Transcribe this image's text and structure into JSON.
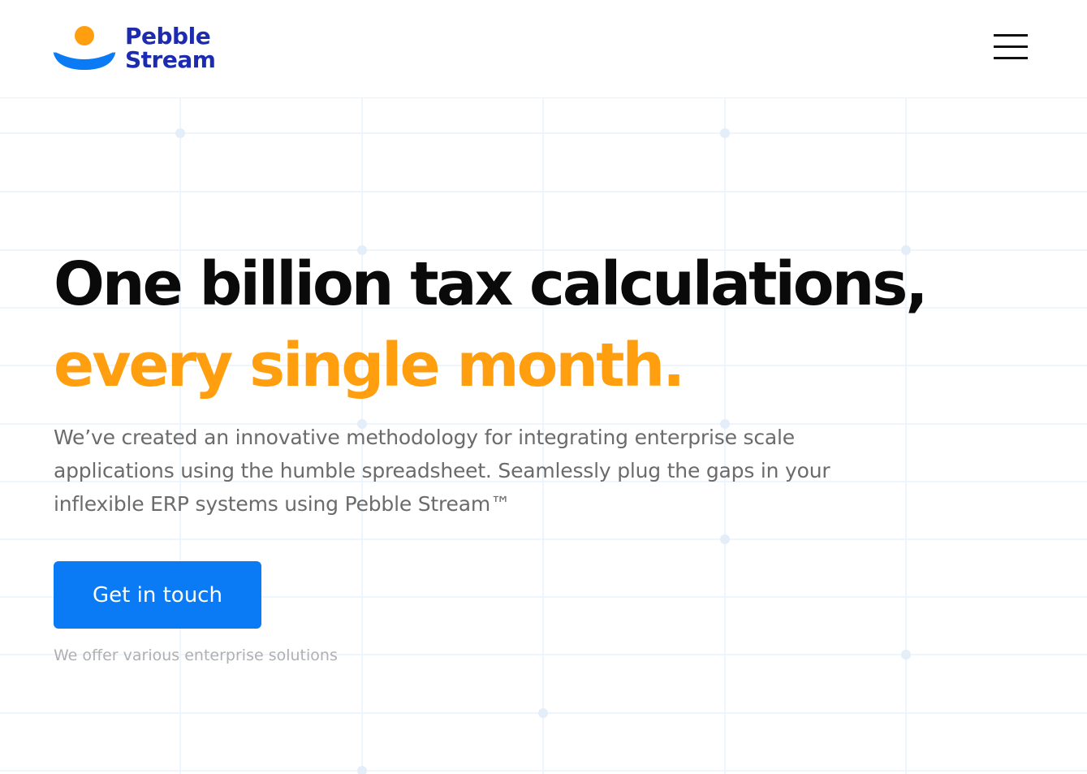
{
  "brand": {
    "name_line1": "Pebble",
    "name_line2": "Stream",
    "colors": {
      "dot": "#ff9e0f",
      "smile": "#0b7bf5",
      "wordmark": "#1c2bb0"
    }
  },
  "header": {
    "menu_icon": "hamburger-menu-icon"
  },
  "hero": {
    "headline_line1": "One billion tax calculations,",
    "headline_line2": "every single month.",
    "intro": "We’ve created an innovative methodology for integrating enterprise scale applications using the humble spreadsheet. Seamlessly plug the gaps in your inflexible ERP systems using Pebble Stream™",
    "cta_label": "Get in touch",
    "cta_note": "We offer various enterprise solutions"
  },
  "colors": {
    "accent": "#ff9e0f",
    "primary_button": "#0b7bf5",
    "headline": "#0a0a0a",
    "body_text": "#6b6b6b",
    "muted_text": "#b0b0b0"
  }
}
